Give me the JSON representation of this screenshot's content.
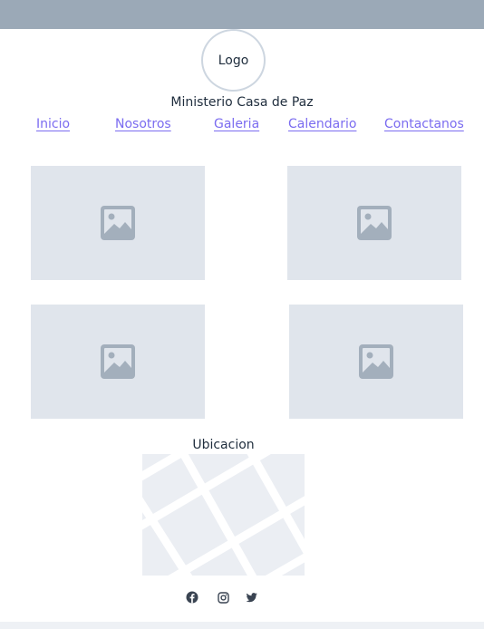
{
  "header": {
    "logo_text": "Logo",
    "site_title": "Ministerio Casa de Paz"
  },
  "nav": {
    "items": [
      {
        "label": "Inicio"
      },
      {
        "label": "Nosotros"
      },
      {
        "label": "Galeria"
      },
      {
        "label": "Calendario"
      },
      {
        "label": "Contactanos"
      }
    ]
  },
  "gallery": {
    "images": [
      {
        "icon": "image-placeholder-icon"
      },
      {
        "icon": "image-placeholder-icon"
      },
      {
        "icon": "image-placeholder-icon"
      },
      {
        "icon": "image-placeholder-icon"
      }
    ]
  },
  "location": {
    "label": "Ubicacion",
    "map_icon": "map-placeholder"
  },
  "socials": [
    {
      "icon": "facebook-icon"
    },
    {
      "icon": "instagram-icon"
    },
    {
      "icon": "twitter-icon"
    }
  ],
  "colors": {
    "top_bar": "#9ba9b7",
    "link": "#7b6cf0",
    "placeholder_bg": "#e0e5ec",
    "placeholder_icon": "#a3afbc",
    "text": "#1f2d3d"
  }
}
